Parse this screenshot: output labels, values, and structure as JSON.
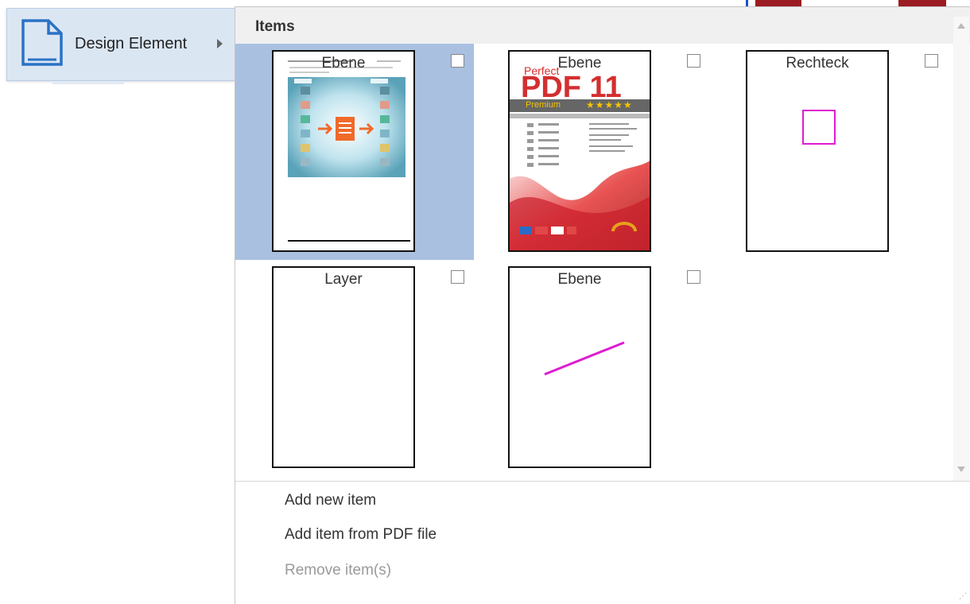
{
  "menu": {
    "label": "Design Element",
    "icon": "document-page-icon"
  },
  "panel": {
    "header": "Items",
    "items": [
      {
        "title": "Ebene",
        "selected": true,
        "checked": false,
        "preview": "document-page"
      },
      {
        "title": "Ebene",
        "selected": false,
        "checked": false,
        "preview": "perfect-pdf-cover"
      },
      {
        "title": "Rechteck",
        "selected": false,
        "checked": false,
        "preview": "magenta-rectangle"
      },
      {
        "title": "Layer",
        "selected": false,
        "checked": false,
        "preview": "blank"
      },
      {
        "title": "Ebene",
        "selected": false,
        "checked": false,
        "preview": "magenta-line"
      }
    ],
    "cover_text": {
      "brand": "Perfect",
      "product": "PDF 11",
      "edition": "Premium",
      "stars": "★★★★★"
    },
    "commands": {
      "add_new": "Add new item",
      "add_from_pdf": "Add item from PDF file",
      "remove": "Remove item(s)"
    }
  },
  "colors": {
    "selection": "#a9c0e0",
    "accent": "#e01bd0",
    "pdf_red": "#d32f2f"
  }
}
